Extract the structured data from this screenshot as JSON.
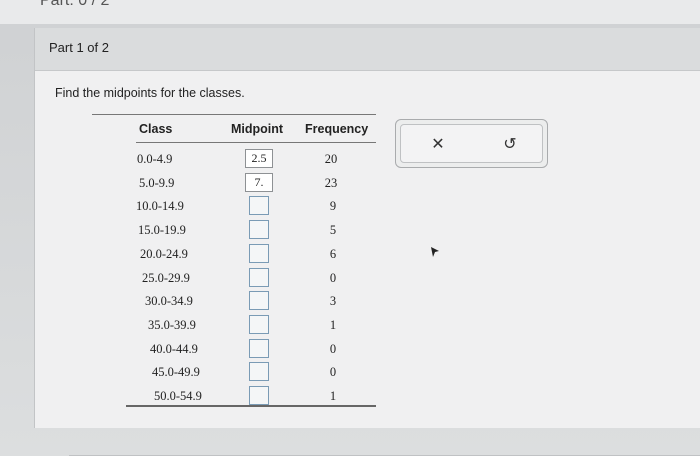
{
  "top_strip": {
    "text": "Part: 0 / 2"
  },
  "part_header": {
    "label": "Part 1 of 2"
  },
  "instruction": "Find the midpoints for the classes.",
  "table": {
    "headers": {
      "class": "Class",
      "midpoint": "Midpoint",
      "frequency": "Frequency"
    },
    "rows": [
      {
        "class": "0.0-4.9",
        "midpoint": "2.5",
        "frequency": "20"
      },
      {
        "class": "5.0-9.9",
        "midpoint": "7.",
        "frequency": "23"
      },
      {
        "class": "10.0-14.9",
        "midpoint": "",
        "frequency": "9"
      },
      {
        "class": "15.0-19.9",
        "midpoint": "",
        "frequency": "5"
      },
      {
        "class": "20.0-24.9",
        "midpoint": "",
        "frequency": "6"
      },
      {
        "class": "25.0-29.9",
        "midpoint": "",
        "frequency": "0"
      },
      {
        "class": "30.0-34.9",
        "midpoint": "",
        "frequency": "3"
      },
      {
        "class": "35.0-39.9",
        "midpoint": "",
        "frequency": "1"
      },
      {
        "class": "40.0-44.9",
        "midpoint": "",
        "frequency": "0"
      },
      {
        "class": "45.0-49.9",
        "midpoint": "",
        "frequency": "0"
      },
      {
        "class": "50.0-54.9",
        "midpoint": "",
        "frequency": "1"
      }
    ]
  },
  "actions": {
    "clear_glyph": "✕",
    "undo_glyph": "↺",
    "clear_icon": "close-icon",
    "undo_icon": "undo-icon"
  },
  "colors": {
    "empty_box_border": "#7a9bb5",
    "header_bg": "#dadcdd",
    "card_bg": "#f0f0f1"
  }
}
